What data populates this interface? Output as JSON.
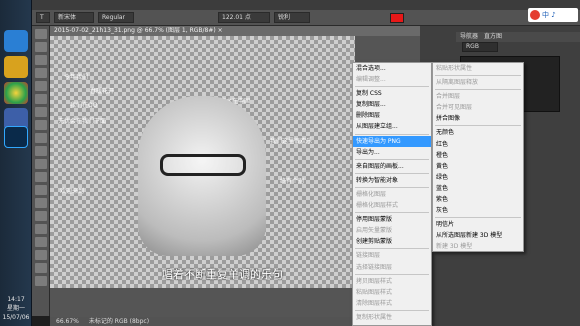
{
  "taskbar": {
    "icons": [
      "app-1",
      "app-2",
      "app-3",
      "app-4",
      "app-5",
      "photoshop"
    ],
    "clock_time": "14:17",
    "clock_day": "星期一",
    "clock_date": "15/07/06"
  },
  "options": {
    "font_family": "新宋体",
    "font_style": "Regular",
    "font_size": "122.01 点",
    "antialias": "锐利",
    "color_swatch": "#e81818"
  },
  "document": {
    "tab_title": "2015-07-02_21h13_31.png @ 66.7% (图层 1, RGB/8#) ×",
    "caption": "唱着不断重复单调的乐句",
    "zoom": "66.67%",
    "doc_info": "未标记的 RGB (8bpc)"
  },
  "ghost_text": [
    "今年我们",
    "春暖花开",
    "流水在中国",
    "我们在QQ",
    "无忧会在我们下面",
    "我们这里很欢乐",
    "终有个别",
    "欢迎来到"
  ],
  "panels": {
    "tabs": [
      "导航器",
      "直方图"
    ],
    "channel": "RGB"
  },
  "logo": {
    "text": "中 ♪"
  },
  "menu1": {
    "items": [
      {
        "label": "混合选项...",
        "enabled": true
      },
      {
        "label": "编辑调整...",
        "enabled": false
      },
      {
        "sep": true
      },
      {
        "label": "复制 CSS",
        "enabled": true
      },
      {
        "label": "复制图层...",
        "enabled": true
      },
      {
        "label": "删除图层",
        "enabled": true
      },
      {
        "label": "从图层建立组...",
        "enabled": true
      },
      {
        "sep": true
      },
      {
        "label": "快速导出为 PNG",
        "enabled": true,
        "selected": true
      },
      {
        "label": "导出为...",
        "enabled": true
      },
      {
        "sep": true
      },
      {
        "label": "来自图层的画板...",
        "enabled": true
      },
      {
        "sep": true
      },
      {
        "label": "转换为智能对象",
        "enabled": true
      },
      {
        "sep": true
      },
      {
        "label": "栅格化图层",
        "enabled": false
      },
      {
        "label": "栅格化图层样式",
        "enabled": false
      },
      {
        "sep": true
      },
      {
        "label": "停用图层蒙版",
        "enabled": true
      },
      {
        "label": "启用矢量蒙版",
        "enabled": false
      },
      {
        "label": "创建剪贴蒙版",
        "enabled": true
      },
      {
        "sep": true
      },
      {
        "label": "链接图层",
        "enabled": false
      },
      {
        "label": "选择链接图层",
        "enabled": false
      },
      {
        "sep": true
      },
      {
        "label": "拷贝图层样式",
        "enabled": false
      },
      {
        "label": "粘贴图层样式",
        "enabled": false
      },
      {
        "label": "清除图层样式",
        "enabled": false
      },
      {
        "sep": true
      },
      {
        "label": "复制形状属性",
        "enabled": false
      }
    ]
  },
  "menu2": {
    "items": [
      {
        "label": "粘贴形状属性",
        "enabled": false
      },
      {
        "sep": true
      },
      {
        "label": "从隔离图层释放",
        "enabled": false
      },
      {
        "sep": true
      },
      {
        "label": "合并图层",
        "enabled": false
      },
      {
        "label": "合并可见图层",
        "enabled": false
      },
      {
        "label": "拼合图像",
        "enabled": true
      },
      {
        "sep": true
      },
      {
        "label": "无颜色",
        "enabled": true
      },
      {
        "label": "红色",
        "enabled": true
      },
      {
        "label": "橙色",
        "enabled": true
      },
      {
        "label": "黄色",
        "enabled": true
      },
      {
        "label": "绿色",
        "enabled": true
      },
      {
        "label": "蓝色",
        "enabled": true
      },
      {
        "label": "紫色",
        "enabled": true
      },
      {
        "label": "灰色",
        "enabled": true
      },
      {
        "sep": true
      },
      {
        "label": "明信片",
        "enabled": true
      },
      {
        "label": "从所选图层新建 3D 模型",
        "enabled": true
      },
      {
        "label": "新建 3D 模型",
        "enabled": false
      }
    ]
  }
}
